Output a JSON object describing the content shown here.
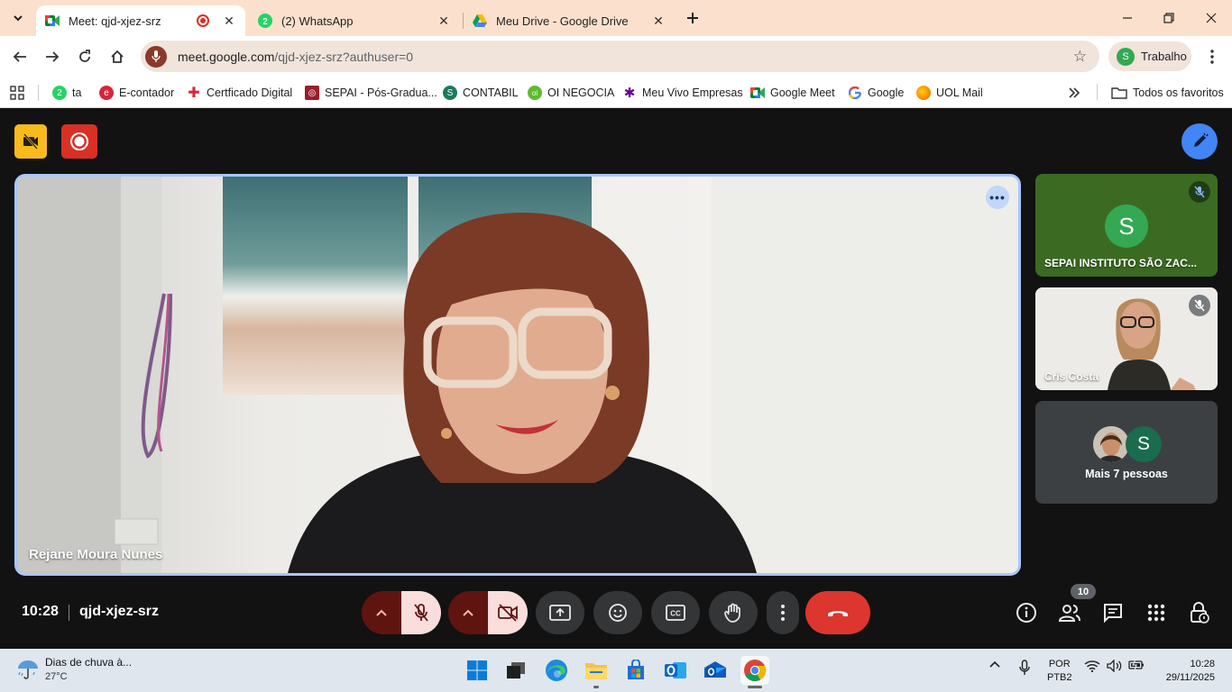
{
  "browser": {
    "tabs": [
      {
        "title": "Meet: qjd-xjez-srz",
        "active": true,
        "recording": true
      },
      {
        "title": "(2) WhatsApp",
        "badge": "2"
      },
      {
        "title": "Meu Drive - Google Drive"
      }
    ],
    "url_host": "meet.google.com",
    "url_path": "/qjd-xjez-srz?authuser=0",
    "profile_initial": "S",
    "profile_name": "Trabalho"
  },
  "bookmarks": [
    {
      "label": "ta",
      "badge": "2",
      "color": "#25d366"
    },
    {
      "label": "E-contador",
      "color": "#d6263b"
    },
    {
      "label": "Certficado Digital",
      "color": "#d6263b"
    },
    {
      "label": "SEPAI - Pós-Gradua...",
      "color": "#9b1c2a"
    },
    {
      "label": "CONTABIL",
      "badge": "S",
      "color": "#1b7a5a"
    },
    {
      "label": "OI NEGOCIA",
      "badge": "oi",
      "color": "#5dbb2f"
    },
    {
      "label": "Meu Vivo Empresas",
      "color": "#660099"
    },
    {
      "label": "Google Meet",
      "color": "#00832d"
    },
    {
      "label": "Google",
      "color": "#4285f4"
    },
    {
      "label": "UOL Mail",
      "color": "#f4a700"
    }
  ],
  "all_bookmarks_label": "Todos os favoritos",
  "meet": {
    "main_participant": "Rejane Moura Nunes",
    "participants": [
      {
        "name": "SEPAI INSTITUTO SÃO ZAC...",
        "initial": "S",
        "muted": true
      },
      {
        "name": "Cris Costa",
        "muted": true
      }
    ],
    "more_people_label": "Mais 7 pessoas",
    "more_initial": "S",
    "time": "10:28",
    "meeting_code": "qjd-xjez-srz",
    "participant_count": "10",
    "colors": {
      "accent": "#a8c7fa",
      "hangup": "#dc362e",
      "record": "#d93025",
      "yellow": "#f9ba1d",
      "pen": "#4285f4"
    }
  },
  "taskbar": {
    "weather_text": "Dias de chuva à...",
    "weather_temp": "27°C",
    "lang_1": "POR",
    "lang_2": "PTB2",
    "clock_time": "10:28",
    "clock_date": "29/11/2025"
  }
}
